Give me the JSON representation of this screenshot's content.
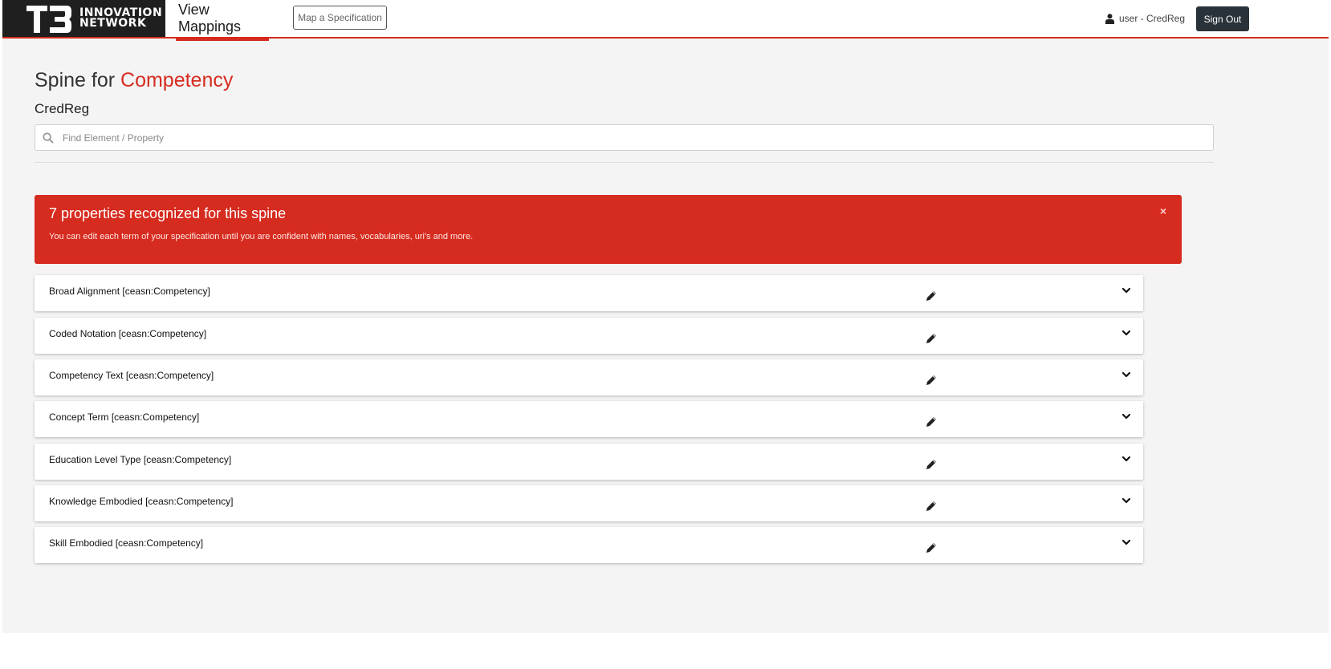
{
  "header": {
    "logo_mark": "T3",
    "logo_line1": "INNOVATION",
    "logo_line2": "NETWORK",
    "nav_view_mappings": "View Mappings",
    "nav_map_spec": "Map a Specification",
    "user_label": "user - CredReg",
    "sign_out": "Sign Out",
    "accent_color": "#d62b1f"
  },
  "page": {
    "title_prefix": "Spine for",
    "title_accent": "Competency",
    "subtitle": "CredReg"
  },
  "search": {
    "placeholder": "Find Element / Property",
    "value": "",
    "icon": "search-icon"
  },
  "alert": {
    "title": "7 properties recognized for this spine",
    "text": "You can edit each term of your specification until you are confident with names, vocabularies, uri's and more.",
    "close": "×",
    "color": "#d62b1f"
  },
  "properties": [
    {
      "label": "Broad Alignment [ceasn:Competency]"
    },
    {
      "label": "Coded Notation [ceasn:Competency]"
    },
    {
      "label": "Competency Text [ceasn:Competency]"
    },
    {
      "label": "Concept Term [ceasn:Competency]"
    },
    {
      "label": "Education Level Type [ceasn:Competency]"
    },
    {
      "label": "Knowledge Embodied [ceasn:Competency]"
    },
    {
      "label": "Skill Embodied [ceasn:Competency]"
    }
  ]
}
